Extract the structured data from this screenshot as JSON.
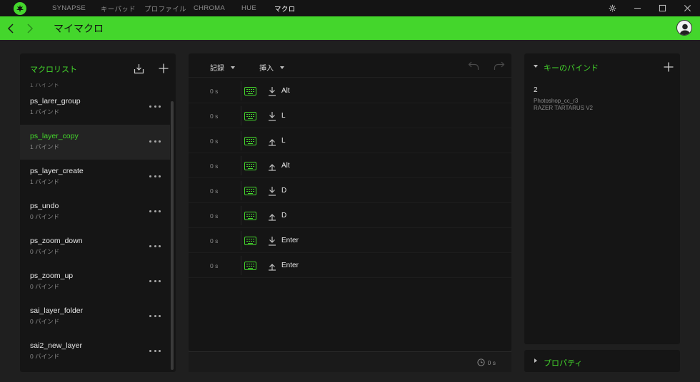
{
  "colors": {
    "accent": "#44d62c",
    "panel": "#151515",
    "background": "#1f1f1f"
  },
  "topnav": {
    "items": [
      {
        "label": "SYNAPSE",
        "active": false
      },
      {
        "label": "キーパッド",
        "active": false
      },
      {
        "label": "プロファイル",
        "active": false
      },
      {
        "label": "CHROMA",
        "active": false
      },
      {
        "label": "HUE",
        "active": false
      },
      {
        "label": "マクロ",
        "active": true
      }
    ]
  },
  "window_controls": [
    "settings-icon",
    "minimize-icon",
    "maximize-icon",
    "close-icon"
  ],
  "header": {
    "title": "マイマクロ"
  },
  "macro_list": {
    "title": "マクロリスト",
    "partial_item": "1 バインド",
    "items": [
      {
        "name": "ps_larer_group",
        "binds": "1 バインド",
        "selected": false
      },
      {
        "name": "ps_layer_copy",
        "binds": "1 バインド",
        "selected": true
      },
      {
        "name": "ps_layer_create",
        "binds": "1 バインド",
        "selected": false
      },
      {
        "name": "ps_undo",
        "binds": "0 バインド",
        "selected": false
      },
      {
        "name": "ps_zoom_down",
        "binds": "0 バインド",
        "selected": false
      },
      {
        "name": "ps_zoom_up",
        "binds": "0 バインド",
        "selected": false
      },
      {
        "name": "sai_layer_folder",
        "binds": "0 バインド",
        "selected": false
      },
      {
        "name": "sai2_new_layer",
        "binds": "0 バインド",
        "selected": false
      }
    ]
  },
  "editor": {
    "record_label": "記録",
    "insert_label": "挿入",
    "rows": [
      {
        "delay": "0 s",
        "direction": "down",
        "key": "Alt"
      },
      {
        "delay": "0 s",
        "direction": "down",
        "key": "L"
      },
      {
        "delay": "0 s",
        "direction": "up",
        "key": "L"
      },
      {
        "delay": "0 s",
        "direction": "up",
        "key": "Alt"
      },
      {
        "delay": "0 s",
        "direction": "down",
        "key": "D"
      },
      {
        "delay": "0 s",
        "direction": "up",
        "key": "D"
      },
      {
        "delay": "0 s",
        "direction": "down",
        "key": "Enter"
      },
      {
        "delay": "0 s",
        "direction": "up",
        "key": "Enter"
      }
    ],
    "total_time": "0 s"
  },
  "key_binds": {
    "title": "キーのバインド",
    "count": "2",
    "profile": "Photoshop_cc_r3",
    "device": "RAZER TARTARUS V2"
  },
  "properties": {
    "title": "プロパティ"
  }
}
